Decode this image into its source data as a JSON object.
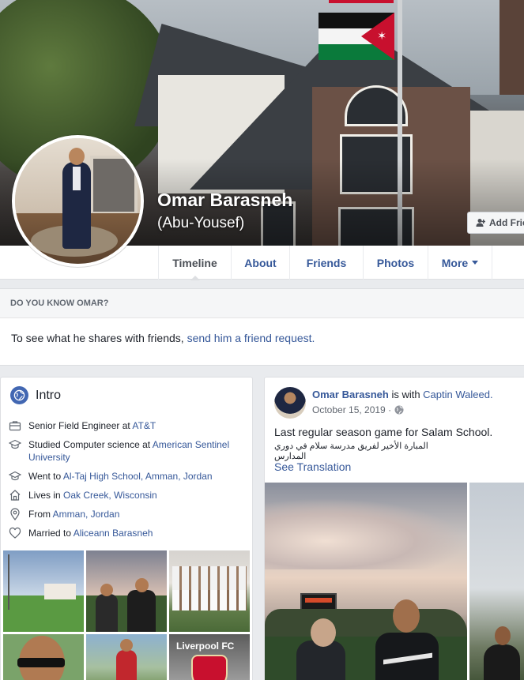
{
  "profile": {
    "name": "Omar Barasneh",
    "nickname": "(Abu-Yousef)",
    "add_friend_label": "Add Frie"
  },
  "nav": {
    "tabs": [
      {
        "label": "Timeline"
      },
      {
        "label": "About"
      },
      {
        "label": "Friends"
      },
      {
        "label": "Photos"
      },
      {
        "label": "More"
      }
    ],
    "active": "Timeline"
  },
  "know": {
    "heading": "DO YOU KNOW OMAR?",
    "text": "To see what he shares with friends, ",
    "link": "send him a friend request."
  },
  "intro": {
    "title": "Intro",
    "items": [
      {
        "icon": "briefcase-icon",
        "text": "Senior Field Engineer at ",
        "link": "AT&T"
      },
      {
        "icon": "graduation-cap-icon",
        "text": "Studied Computer science at ",
        "link": "American Sentinel University"
      },
      {
        "icon": "graduation-cap-icon",
        "text": "Went to ",
        "link": "Al-Taj High School, Amman, Jordan"
      },
      {
        "icon": "home-icon",
        "text": "Lives in ",
        "link": "Oak Creek, Wisconsin"
      },
      {
        "icon": "location-pin-icon",
        "text": "From ",
        "link": "Amman, Jordan"
      },
      {
        "icon": "heart-icon",
        "text": "Married to ",
        "link": "Aliceann Barasneh"
      }
    ],
    "photo_label": "Liverpool FC"
  },
  "post": {
    "author": "Omar Barasneh",
    "with_text": " is with ",
    "with_name": "Captin Waleed.",
    "date": "October 15, 2019 · ",
    "text": "Last regular season game for Salam School.",
    "arabic": "المبارة الأخير لفريق مدرسة سلام في دوري المدارس",
    "see_translation": "See Translation"
  },
  "colors": {
    "link": "#365899",
    "brand": "#4267b2",
    "background": "#e9ebee"
  }
}
